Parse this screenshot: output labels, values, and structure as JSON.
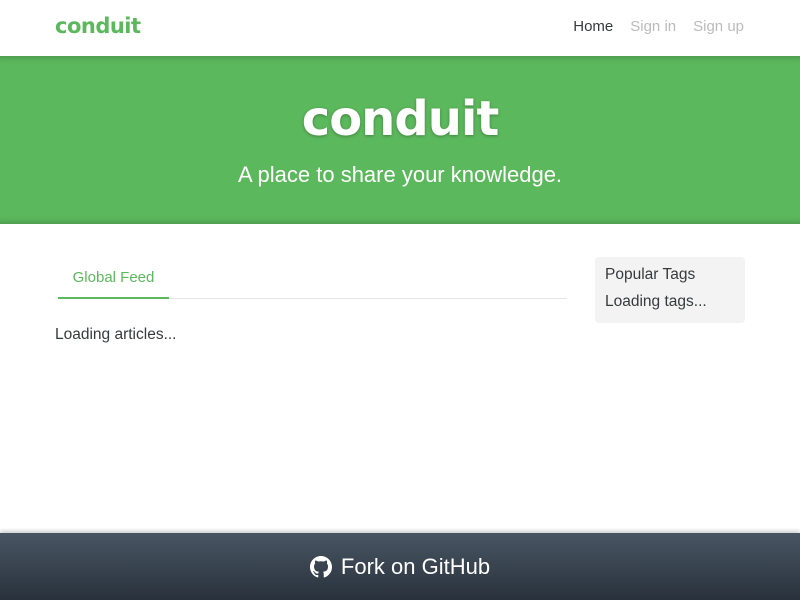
{
  "navbar": {
    "brand": "conduit",
    "links": [
      {
        "label": "Home",
        "active": true
      },
      {
        "label": "Sign in",
        "active": false
      },
      {
        "label": "Sign up",
        "active": false
      }
    ]
  },
  "banner": {
    "title": "conduit",
    "tagline": "A place to share your knowledge."
  },
  "feed": {
    "tabs": [
      {
        "label": "Global Feed",
        "active": true
      }
    ],
    "loading_text": "Loading articles..."
  },
  "sidebar": {
    "heading": "Popular Tags",
    "loading_text": "Loading tags..."
  },
  "footer": {
    "icon": "github-icon",
    "label": "Fork on GitHub"
  },
  "colors": {
    "brand_green": "#5cb85c",
    "nav_inactive": "#bbbbbb",
    "text": "#373a3c",
    "footer_gradient_top": "#485563",
    "footer_gradient_bottom": "#29323c"
  }
}
